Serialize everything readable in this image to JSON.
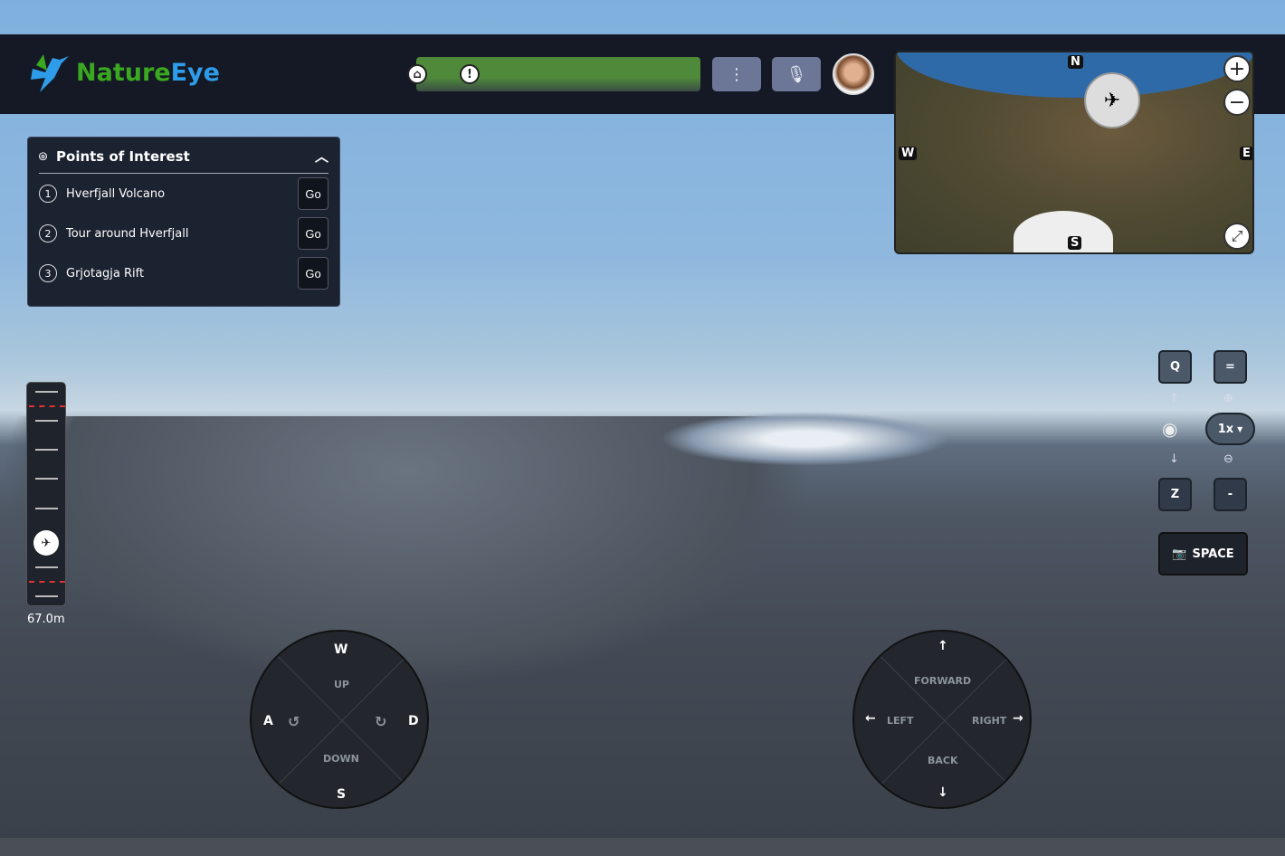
{
  "app": {
    "name_part1": "Nature",
    "name_part2": "Eye"
  },
  "header": {
    "progress_percent": 100,
    "home_marker": "⌂",
    "alert_marker": "!",
    "menu_icon": "more-vertical-icon",
    "mic_icon": "microphone-icon"
  },
  "minimap": {
    "north": "N",
    "south": "S",
    "east": "E",
    "west": "W",
    "zoom_in": "+",
    "zoom_out": "−",
    "expand": "⤢"
  },
  "poi": {
    "title": "Points of Interest",
    "items": [
      {
        "num": "1",
        "name": "Hverfjall Volcano",
        "action": "Go"
      },
      {
        "num": "2",
        "name": "Tour around Hverfjall",
        "action": "Go"
      },
      {
        "num": "3",
        "name": "Grjotagja Rift",
        "action": "Go"
      }
    ]
  },
  "altitude": {
    "value": "67.0m"
  },
  "camera": {
    "tilt_up_key": "Q",
    "tilt_down_key": "Z",
    "zoom_in_key": "=",
    "zoom_out_key": "-",
    "zoom_level": "1x",
    "photo_key": "SPACE"
  },
  "left_pad": {
    "up_key": "W",
    "down_key": "S",
    "left_key": "A",
    "right_key": "D",
    "up_label": "UP",
    "down_label": "DOWN"
  },
  "right_pad": {
    "forward": "FORWARD",
    "back": "BACK",
    "left": "LEFT",
    "right": "RIGHT"
  }
}
